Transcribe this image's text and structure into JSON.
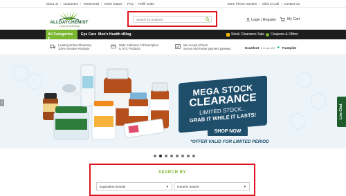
{
  "toplinks": {
    "left": [
      "About us",
      "Guarantee",
      "Testimonial",
      "Order Status",
      "FAQ",
      "Refill Order"
    ],
    "right": [
      "Store Phone Number",
      "Click to Call",
      "Contact Us"
    ]
  },
  "logo": {
    "name": "ALLDAYCHEMIST",
    "tagline": "a way of pharmacy"
  },
  "search": {
    "placeholder": "Search for products"
  },
  "account": {
    "label": "Login | Register"
  },
  "cart": {
    "label": "My Cart"
  },
  "nav": {
    "all_categories": "All Categories",
    "items": [
      "Eye Care",
      "Men's Health",
      "Blog"
    ],
    "promo1": "Stock Clearance Sale",
    "promo2": "Coupons & Offers"
  },
  "features": [
    {
      "line1": "Leading Online Pharmacy",
      "line2": "100% Genuine Products",
      "icon": "truck-icon"
    },
    {
      "line1": "Wide Collection of Prescription",
      "line2": "& OTC Products",
      "icon": "box-icon"
    },
    {
      "line1": "We Accept eCheck",
      "line2": "Secure and Faster payment gateway",
      "icon": "check-icon"
    }
  ],
  "trust": {
    "label": "Excellent",
    "rating": "4.8 out of 5",
    "brand": "Trustpilot"
  },
  "banner": {
    "line1": "MEGA STOCK",
    "line2": "CLEARANCE",
    "line3": "LIMITED STOCK...",
    "line4": "GRAB IT WHILE IT LASTS!",
    "button": "SHOP NOW",
    "offer": "*OFFER VALID FOR LIMITED PERIOD"
  },
  "livechat": "Live Chat",
  "carousel": {
    "count": 8,
    "active": 1
  },
  "searchby": {
    "title": "SEARCH BY",
    "select1": "Equivalent Brands",
    "select2": "Generic Search"
  },
  "colors": {
    "accent_green": "#7bb630",
    "navy": "#1f4e6b",
    "highlight_red": "#e0141e",
    "nav_dark": "#1d1d1d"
  }
}
